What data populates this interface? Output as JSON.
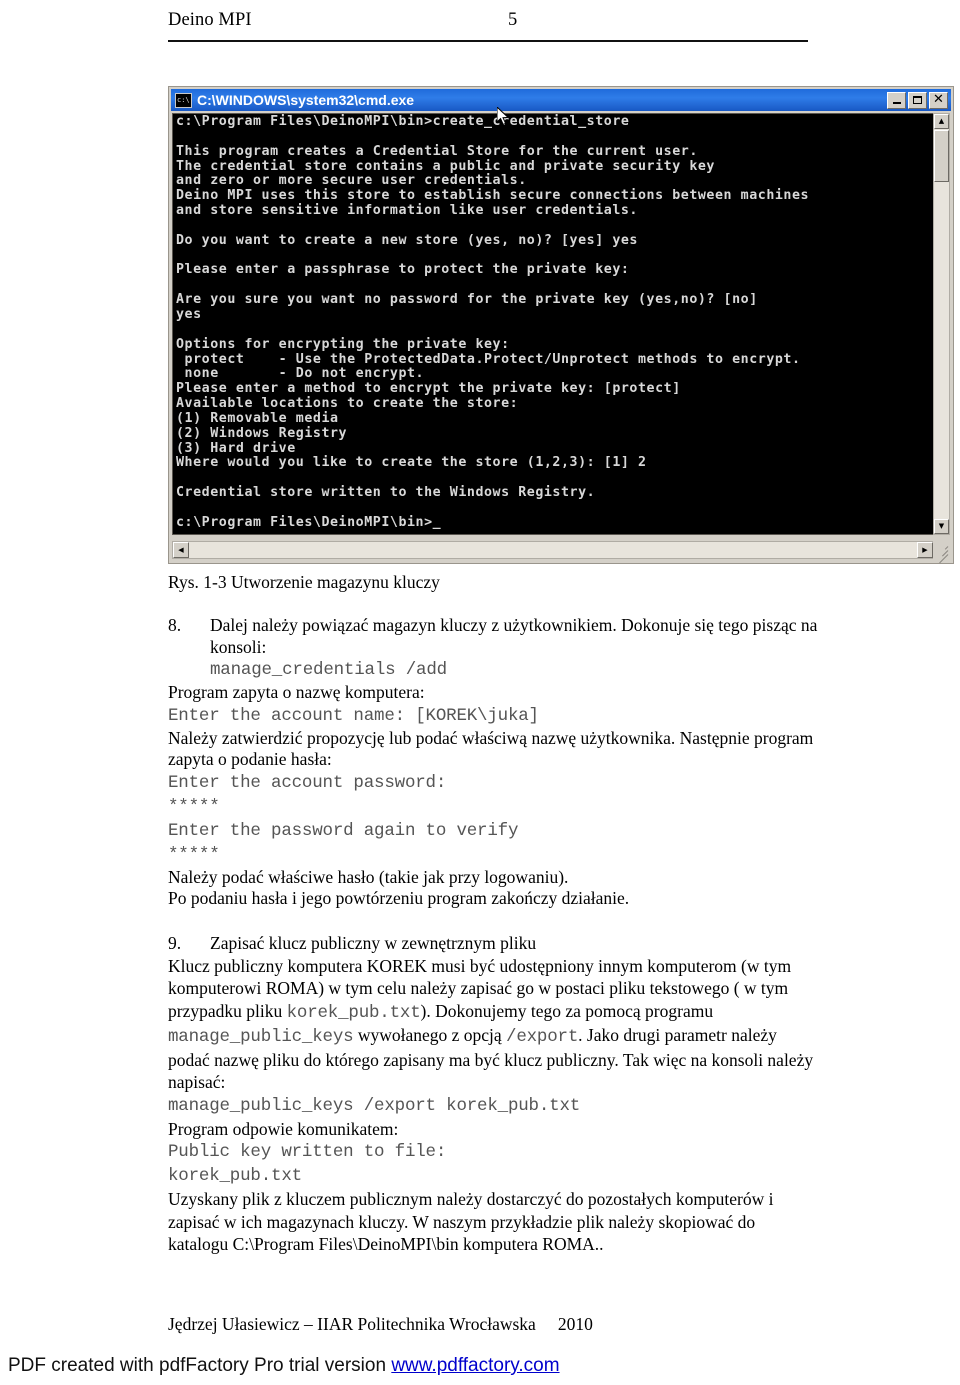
{
  "header": {
    "doc_title": "Deino MPI",
    "page_number": "5"
  },
  "console_window": {
    "title": "C:\\WINDOWS\\system32\\cmd.exe",
    "icon": "console-icon",
    "buttons": {
      "minimize": "minimize-button",
      "maximize": "maximize-button",
      "close": "close-button"
    },
    "content": "c:\\Program Files\\DeinoMPI\\bin>create_credential_store\n\nThis program creates a Credential Store for the current user.\nThe credential store contains a public and private security key\nand zero or more secure user credentials.\nDeino MPI uses this store to establish secure connections between machines\nand store sensitive information like user credentials.\n\nDo you want to create a new store (yes, no)? [yes] yes\n\nPlease enter a passphrase to protect the private key:\n\nAre you sure you want no password for the private key (yes,no)? [no]\nyes\n\nOptions for encrypting the private key:\n protect    - Use the ProtectedData.Protect/Unprotect methods to encrypt.\n none       - Do not encrypt.\nPlease enter a method to encrypt the private key: [protect]\nAvailable locations to create the store:\n(1) Removable media\n(2) Windows Registry\n(3) Hard drive\nWhere would you like to create the store (1,2,3): [1] 2\n\nCredential store written to the Windows Registry.\n\nc:\\Program Files\\DeinoMPI\\bin>_"
  },
  "figure": {
    "caption": "Rys. 1-3 Utworzenie magazynu kluczy"
  },
  "item8": {
    "number": "8.",
    "text_1": "Dalej należy powiązać  magazyn kluczy z użytkownikiem. Dokonuje się tego pisząc na konsoli:",
    "code_1": "manage_credentials /add",
    "text_2": "Program zapyta o nazwę komputera:",
    "code_2": "Enter the account name: [KOREK\\juka]",
    "text_3": "Należy zatwierdzić propozycję lub podać właściwą nazwę użytkownika.  Następnie program zapyta o podanie hasła:",
    "code_3": "Enter the account password:",
    "code_4": "*****",
    "code_5": "Enter the password again to verify",
    "code_6": "*****",
    "text_4": "Należy podać właściwe hasło (takie jak przy logowaniu).",
    "text_5": "Po podaniu hasła i jego powtórzeniu program zakończy działanie."
  },
  "item9": {
    "number": "9.",
    "title": "Zapisać klucz publiczny w zewnętrznym pliku",
    "para_1a": "Klucz publiczny komputera KOREK musi być udostępniony innym komputerom (w tym komputerowi ROMA) w tym celu należy zapisać go w postaci pliku tekstowego ( w tym przypadku pliku ",
    "code_inline_1": "korek_pub.txt",
    "para_1b": "). Dokonujemy tego za pomocą programu ",
    "code_inline_2": "manage_public_keys",
    "para_1c": " wywołanego z opcją ",
    "code_inline_3": "/export",
    "para_1d": ". Jako drugi parametr należy podać nazwę pliku do którego zapisany ma być klucz publiczny. Tak więc na konsoli należy napisać:",
    "code_1": "manage_public_keys /export korek_pub.txt",
    "text_2": "Program odpowie komunikatem:",
    "code_2": "Public key written to file:",
    "code_3": "korek_pub.txt",
    "para_2": "Uzyskany plik z kluczem publicznym należy dostarczyć do pozostałych komputerów i zapisać w ich magazynach kluczy. W naszym przykładzie plik należy skopiować do katalogu C:\\Program Files\\DeinoMPI\\bin komputera ROMA.."
  },
  "footer": {
    "author_line": "Jędrzej Ułasiewicz – IIAR Politechnika Wrocławska",
    "year": "2010"
  },
  "pdf_footer": {
    "prefix": "PDF created with pdfFactory Pro trial version ",
    "link": "www.pdffactory.com"
  }
}
